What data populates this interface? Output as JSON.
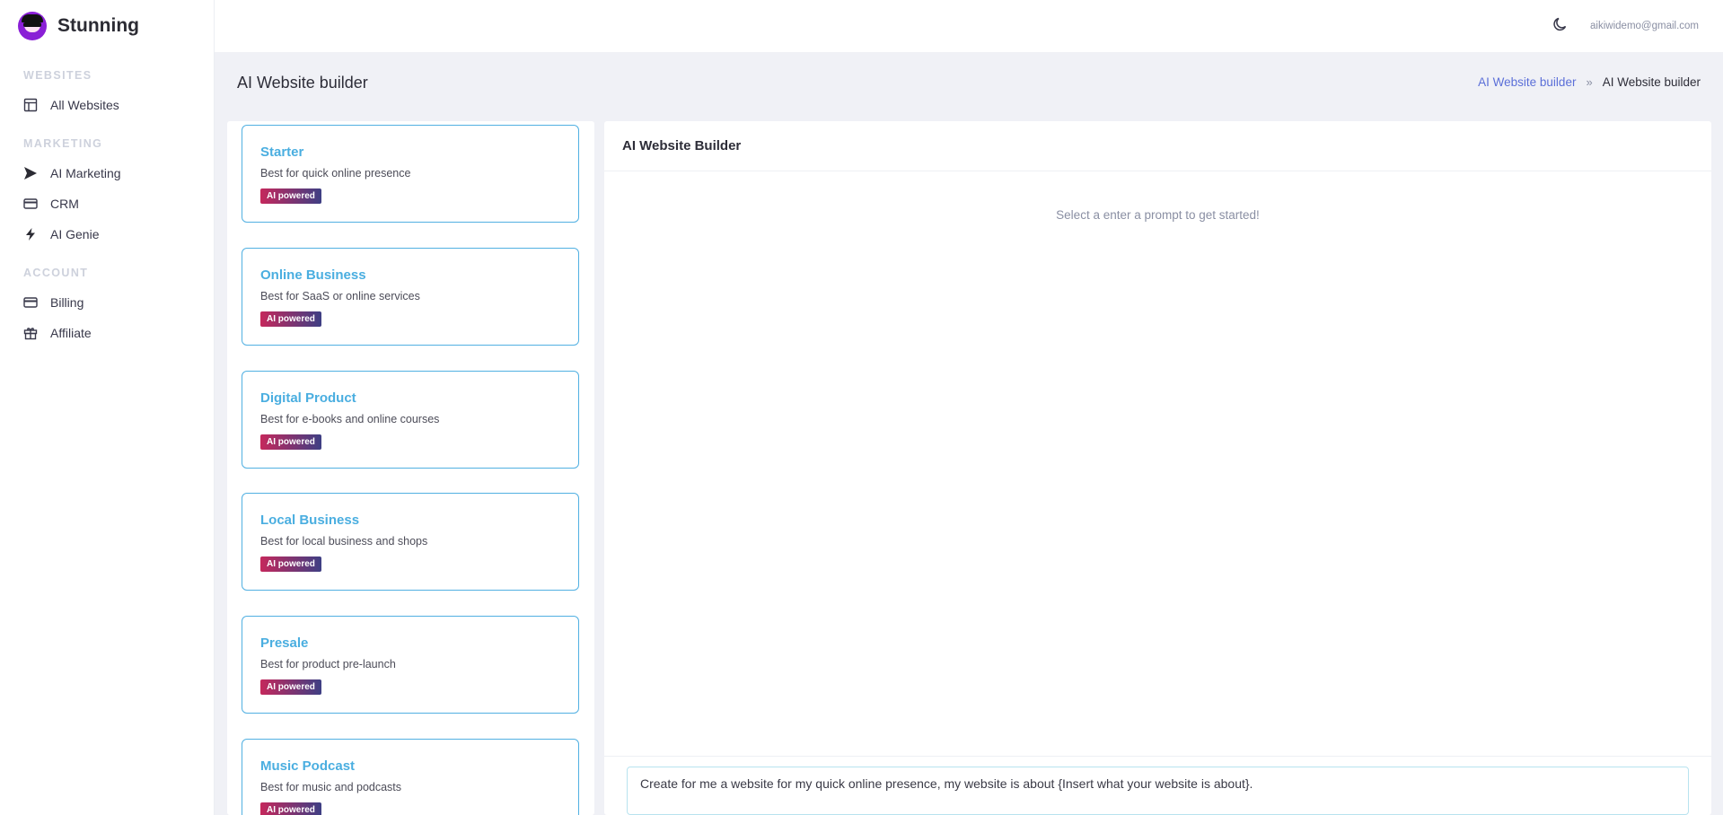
{
  "brand": {
    "name": "Stunning"
  },
  "sidebar": {
    "sections": [
      {
        "title": "WEBSITES",
        "items": [
          {
            "label": "All Websites",
            "icon": "layout-icon"
          }
        ]
      },
      {
        "title": "MARKETING",
        "items": [
          {
            "label": "AI Marketing",
            "icon": "send-icon"
          },
          {
            "label": "CRM",
            "icon": "card-icon"
          },
          {
            "label": "AI Genie",
            "icon": "bolt-icon"
          }
        ]
      },
      {
        "title": "ACCOUNT",
        "items": [
          {
            "label": "Billing",
            "icon": "card-icon"
          },
          {
            "label": "Affiliate",
            "icon": "gift-icon"
          }
        ]
      }
    ]
  },
  "topbar": {
    "theme_icon": "moon-icon",
    "user_email": "aikiwidemo@gmail.com"
  },
  "page": {
    "title": "AI Website builder",
    "breadcrumb": {
      "link": "AI Website builder",
      "separator": "»",
      "current": "AI Website builder"
    }
  },
  "templates": [
    {
      "title": "Starter",
      "description": "Best for quick online presence",
      "badge": "AI powered"
    },
    {
      "title": "Online Business",
      "description": "Best for SaaS or online services",
      "badge": "AI powered"
    },
    {
      "title": "Digital Product",
      "description": "Best for e-books and online courses",
      "badge": "AI powered"
    },
    {
      "title": "Local Business",
      "description": "Best for local business and shops",
      "badge": "AI powered"
    },
    {
      "title": "Presale",
      "description": "Best for product pre-launch",
      "badge": "AI powered"
    },
    {
      "title": "Music Podcast",
      "description": "Best for music and podcasts",
      "badge": "AI powered"
    }
  ],
  "builder": {
    "title": "AI Website Builder",
    "hint": "Select a enter a prompt to get started!",
    "prompt_value": "Create for me a website for my quick online presence, my website is about {Insert what your website is about}."
  },
  "colors": {
    "accent": "#4aaee0",
    "link": "#5b6fd8",
    "brand": "#8a1fd6",
    "badge_start": "#c5285c",
    "badge_end": "#3e3f84"
  }
}
